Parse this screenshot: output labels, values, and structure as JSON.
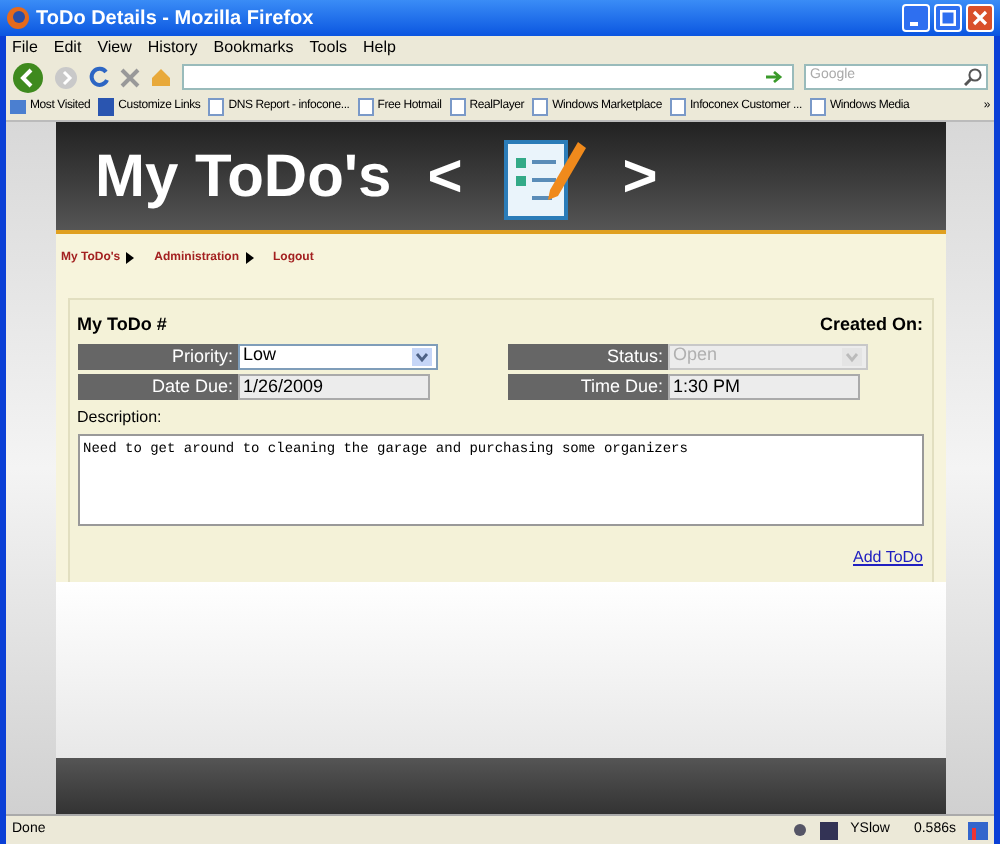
{
  "window": {
    "title": "ToDo Details - Mozilla Firefox"
  },
  "menu": [
    "File",
    "Edit",
    "View",
    "History",
    "Bookmarks",
    "Tools",
    "Help"
  ],
  "search": {
    "placeholder": "Google"
  },
  "bookmarks": [
    {
      "label": "Most Visited",
      "kind": "folder"
    },
    {
      "label": "Customize Links",
      "kind": "logo"
    },
    {
      "label": "DNS Report - infocone...",
      "kind": "page"
    },
    {
      "label": "Free Hotmail",
      "kind": "page"
    },
    {
      "label": "RealPlayer",
      "kind": "page"
    },
    {
      "label": "Windows Marketplace",
      "kind": "page"
    },
    {
      "label": "Infoconex Customer ...",
      "kind": "page"
    },
    {
      "label": "Windows Media",
      "kind": "page"
    }
  ],
  "overflow": "»",
  "header": {
    "title": "My ToDo's",
    "prev": "<",
    "next": ">"
  },
  "nav": [
    "My ToDo's",
    "Administration",
    "Logout"
  ],
  "form": {
    "heading": "My ToDo #",
    "created": "Created On:",
    "priority": {
      "label": "Priority:",
      "value": "Low",
      "disabled": false
    },
    "status": {
      "label": "Status:",
      "value": "Open",
      "disabled": true
    },
    "date": {
      "label": "Date Due:",
      "value": "1/26/2009"
    },
    "time": {
      "label": "Time Due:",
      "value": "1:30 PM"
    },
    "description_label": "Description:",
    "description": "Need to get around to cleaning the garage and purchasing some organizers",
    "add": "Add ToDo"
  },
  "status_bar": {
    "text": "Done",
    "yslow": "YSlow",
    "time": "0.586s"
  }
}
